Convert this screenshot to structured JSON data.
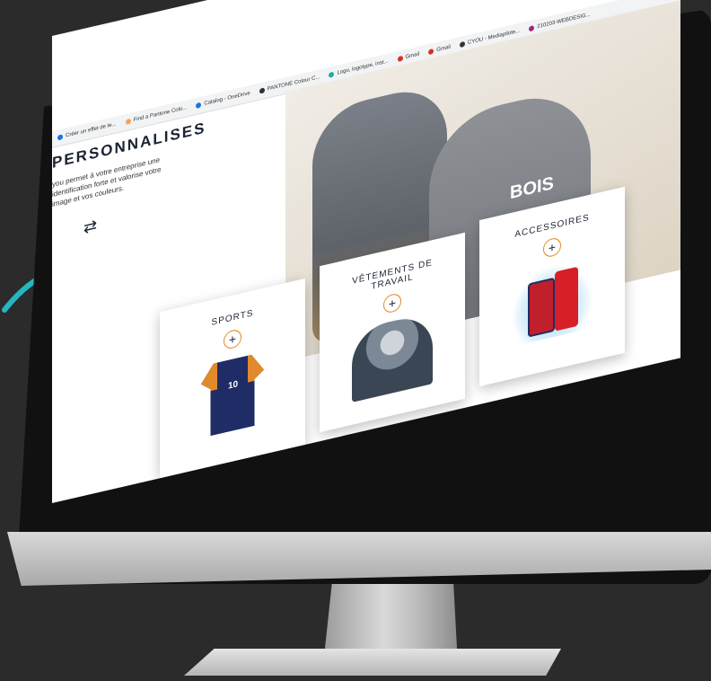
{
  "bookmarks": [
    {
      "label": "Créer un effet de te..."
    },
    {
      "label": "Find a Pantone Colo..."
    },
    {
      "label": "Catalog - OneDrive"
    },
    {
      "label": "PANTONE Colour C..."
    },
    {
      "label": "Logo, logotype, inst..."
    },
    {
      "label": "Gmail"
    },
    {
      "label": "Gmail"
    },
    {
      "label": "CYOU - Mediapilote..."
    },
    {
      "label": "210203-WEBDESIG..."
    }
  ],
  "page": {
    "heading": "PERSONNALISES",
    "intro": "you permet à votre entreprise une identification forte et valorise votre image et vos couleurs.",
    "swap_glyph": "⇄"
  },
  "hero": {
    "brand": "BOIS"
  },
  "cards": [
    {
      "title": "SPORTS",
      "plus": "+"
    },
    {
      "title": "VÊTEMENTS DE TRAVAIL",
      "plus": "+"
    },
    {
      "title": "ACCESSOIRES",
      "plus": "+"
    }
  ],
  "shirt_number": "10",
  "colors": {
    "accent": "#e08a2b",
    "navy": "#1f2c66",
    "arrow": "#23b7c2"
  }
}
